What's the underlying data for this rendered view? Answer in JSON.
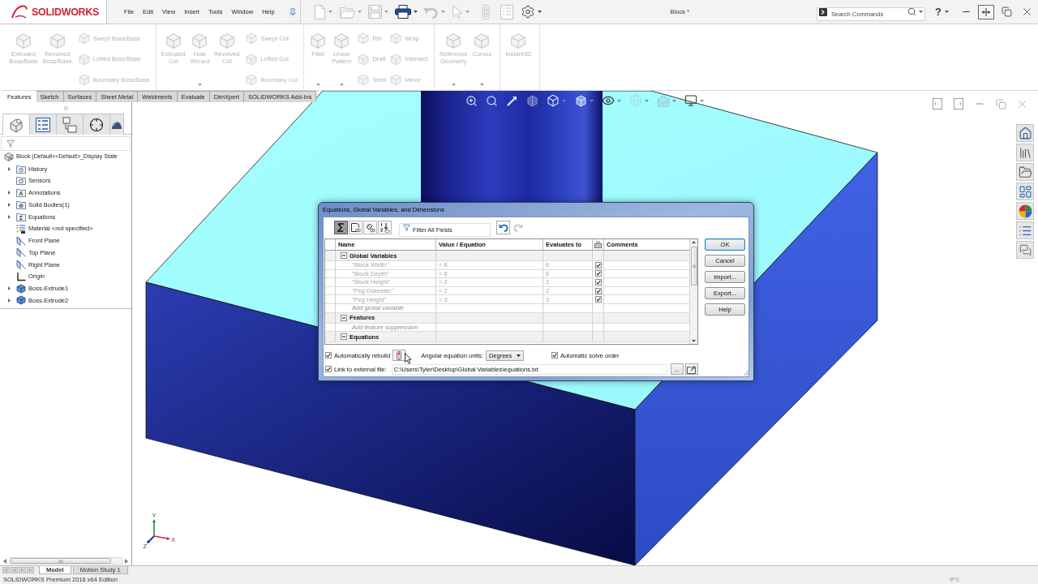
{
  "app": {
    "logo": "SOLIDWORKS",
    "menu": [
      "File",
      "Edit",
      "View",
      "Insert",
      "Tools",
      "Window",
      "Help"
    ],
    "quick_access": [
      {
        "kind": "new",
        "menu": true,
        "disabled": true
      },
      {
        "kind": "open",
        "menu": true,
        "disabled": true
      },
      {
        "kind": "save",
        "menu": true,
        "disabled": true
      },
      {
        "kind": "print",
        "menu": true,
        "disabled": false
      },
      {
        "kind": "undo",
        "menu": true,
        "disabled": true
      },
      {
        "kind": "select",
        "menu": true,
        "disabled": true
      },
      {
        "kind": "rebuild",
        "menu": false,
        "disabled": true
      },
      {
        "kind": "properties",
        "menu": false,
        "disabled": true
      },
      {
        "kind": "options",
        "menu": true,
        "disabled": false
      }
    ],
    "document_title": "Block *",
    "search": {
      "placeholder": "Search Commands"
    },
    "help": "?"
  },
  "ribbon": {
    "disabled": true,
    "groups": [
      {
        "large": [
          {
            "label": "Extruded Boss/Base",
            "menu": false
          },
          {
            "label": "Revolved Boss/Base",
            "menu": false
          }
        ],
        "small_columns": [
          [
            "Swept Boss/Base",
            "Lofted Boss/Base",
            "Boundary Boss/Base"
          ]
        ]
      },
      {
        "large": [
          {
            "label": "Extruded Cut",
            "menu": false
          },
          {
            "label": "Hole Wizard",
            "menu": true
          },
          {
            "label": "Revolved Cut",
            "menu": false
          }
        ],
        "small_columns": [
          [
            "Swept Cut",
            "Lofted Cut",
            "Boundary Cut"
          ]
        ]
      },
      {
        "large": [
          {
            "label": "Fillet",
            "menu": true
          },
          {
            "label": "Linear Pattern",
            "menu": true
          }
        ],
        "small_columns": [
          [
            "Rib",
            "Draft",
            "Shell"
          ],
          [
            "Wrap",
            "Intersect",
            "Mirror"
          ]
        ]
      },
      {
        "large": [
          {
            "label": "Reference Geometry",
            "menu": true
          },
          {
            "label": "Curves",
            "menu": true
          }
        ]
      },
      {
        "large": [
          {
            "label": "Instant3D",
            "menu": false
          }
        ]
      }
    ]
  },
  "feature_tabs": [
    {
      "label": "Features",
      "selected": true
    },
    {
      "label": "Sketch",
      "selected": false
    },
    {
      "label": "Surfaces",
      "selected": false
    },
    {
      "label": "Sheet Metal",
      "selected": false
    },
    {
      "label": "Weldments",
      "selected": false
    },
    {
      "label": "Evaluate",
      "selected": false
    },
    {
      "label": "DimXpert",
      "selected": false
    },
    {
      "label": "SOLIDWORKS Add-Ins",
      "selected": false
    }
  ],
  "feature_manager": {
    "tabs": [
      {
        "kind": "feature",
        "selected": true
      },
      {
        "kind": "property",
        "selected": false
      },
      {
        "kind": "configuration",
        "selected": false
      },
      {
        "kind": "dimxpert",
        "selected": false
      },
      {
        "kind": "display",
        "selected": false
      }
    ],
    "tree": {
      "label": "Block (Default<<Default>_Display State",
      "kind": "part",
      "children": [
        {
          "label": "History",
          "kind": "history",
          "expandable": true
        },
        {
          "label": "Sensors",
          "kind": "sensors",
          "expandable": false
        },
        {
          "label": "Annotations",
          "kind": "annotations",
          "expandable": true
        },
        {
          "label": "Solid Bodies(1)",
          "kind": "bodies",
          "expandable": true
        },
        {
          "label": "Equations",
          "kind": "equations",
          "expandable": true
        },
        {
          "label": "Material <not specified>",
          "kind": "material",
          "expandable": false
        },
        {
          "label": "Front Plane",
          "kind": "plane",
          "expandable": false
        },
        {
          "label": "Top Plane",
          "kind": "plane",
          "expandable": false
        },
        {
          "label": "Right Plane",
          "kind": "plane",
          "expandable": false
        },
        {
          "label": "Origin",
          "kind": "origin",
          "expandable": false
        },
        {
          "label": "Boss-Extrude1",
          "kind": "extrude",
          "expandable": true
        },
        {
          "label": "Boss-Extrude2",
          "kind": "extrude",
          "expandable": true
        }
      ]
    }
  },
  "viewport": {
    "axis_labels": [
      "Y",
      "X",
      "Z"
    ]
  },
  "dialog": {
    "title": "Equations, Global Variables, and Dimensions",
    "view_buttons": [
      {
        "kind": "equation",
        "selected": true
      },
      {
        "kind": "sketch",
        "selected": false
      },
      {
        "kind": "dimension",
        "selected": false
      },
      {
        "kind": "ordered",
        "selected": false
      }
    ],
    "filter": {
      "placeholder": "Filter All Fields"
    },
    "history_buttons": [
      {
        "kind": "undo",
        "disabled": false
      },
      {
        "kind": "redo",
        "disabled": true
      }
    ],
    "table": {
      "read_only": true,
      "columns": [
        {
          "kind": "text",
          "label": "Name"
        },
        {
          "kind": "text",
          "label": "Value / Equation"
        },
        {
          "kind": "text",
          "label": "Evaluates to"
        },
        {
          "kind": "icon"
        },
        {
          "kind": "text",
          "label": "Comments"
        }
      ],
      "sections": [
        {
          "name": "Global Variables",
          "expanded": true,
          "rows": [
            {
              "name": "\"Block Width\"",
              "value": "= 6",
              "result": "6",
              "checked": true
            },
            {
              "name": "\"Block Depth\"",
              "value": "= 6",
              "result": "6",
              "checked": true
            },
            {
              "name": "\"Block Height\"",
              "value": "= 2",
              "result": "2",
              "checked": true
            },
            {
              "name": "\"Peg Diameter\"",
              "value": "= 2",
              "result": "2",
              "checked": true
            },
            {
              "name": "\"Peg Height\"",
              "value": "= 3",
              "result": "3",
              "checked": true
            }
          ],
          "add_row": {
            "placeholder": "Add global variable"
          }
        },
        {
          "name": "Features",
          "expanded": true,
          "add_row": {
            "placeholder": "Add feature suppression"
          }
        },
        {
          "name": "Equations",
          "expanded": true
        }
      ]
    },
    "buttons": [
      {
        "label": "OK",
        "default": true
      },
      {
        "label": "Cancel",
        "default": false
      },
      {
        "label": "Import...",
        "default": false
      },
      {
        "label": "Export...",
        "default": false
      },
      {
        "label": "Help",
        "default": false
      }
    ],
    "auto_rebuild": {
      "label": "Automatically rebuild",
      "checked": true
    },
    "angular_units": {
      "label": "Angular equation units:",
      "value": "Degrees"
    },
    "auto_solve_order": {
      "label": "Automatic solve order",
      "checked": true
    },
    "external_file": {
      "label": "Link to external file:",
      "checked": true,
      "path": "C:\\Users\\Tyler\\Desktop\\Global Variables\\equations.txt",
      "browse": "..."
    }
  },
  "bottom_tabs": [
    {
      "label": "Model",
      "selected": true
    },
    {
      "label": "Motion Study 1",
      "selected": false
    }
  ],
  "status_bar": {
    "text": "SOLIDWORKS Premium 2016 x64 Edition",
    "units": "IPS"
  }
}
